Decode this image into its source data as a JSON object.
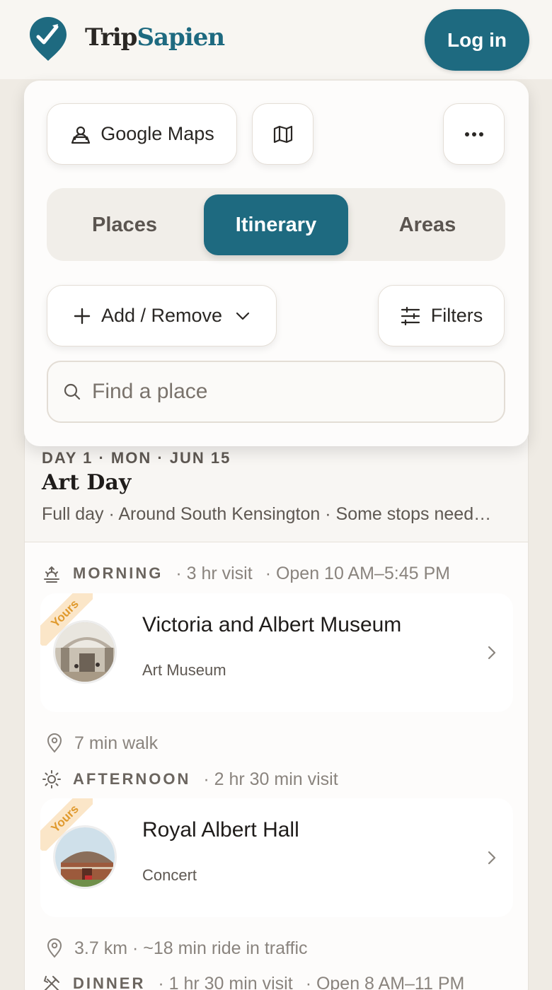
{
  "brand": {
    "name_part1": "Trip",
    "name_part2": "Sapien"
  },
  "header": {
    "login_label": "Log in"
  },
  "toolbar": {
    "google_maps_label": "Google Maps",
    "add_remove_label": "Add / Remove",
    "filters_label": "Filters"
  },
  "tabs": [
    {
      "label": "Places",
      "active": false
    },
    {
      "label": "Itinerary",
      "active": true
    },
    {
      "label": "Areas",
      "active": false
    }
  ],
  "search": {
    "placeholder": "Find a place"
  },
  "day": {
    "kicker": "DAY 1 · MON · JUN 15",
    "title": "Art Day",
    "subtitle": "Full day · Around South Kensington · Some stops need…"
  },
  "slots": [
    {
      "label": "MORNING",
      "meta1": "· 3 hr visit",
      "meta2": "· Open 10 AM–5:45 PM"
    },
    {
      "label": "AFTERNOON",
      "meta1": "· 2 hr 30 min visit",
      "meta2": ""
    },
    {
      "label": "DINNER",
      "meta1": "· 1 hr 30 min visit",
      "meta2": "· Open 8 AM–11 PM"
    }
  ],
  "places": [
    {
      "badge": "Yours",
      "name": "Victoria and Albert Museum",
      "type": "Art Museum"
    },
    {
      "badge": "Yours",
      "name": "Royal Albert Hall",
      "type": "Concert"
    }
  ],
  "travel": [
    {
      "text": "7 min walk"
    },
    {
      "text": "3.7 km · ~18 min ride in traffic"
    }
  ],
  "colors": {
    "accent": "#1e6a80",
    "badge": "#e09a2e",
    "background": "#efebe4"
  }
}
